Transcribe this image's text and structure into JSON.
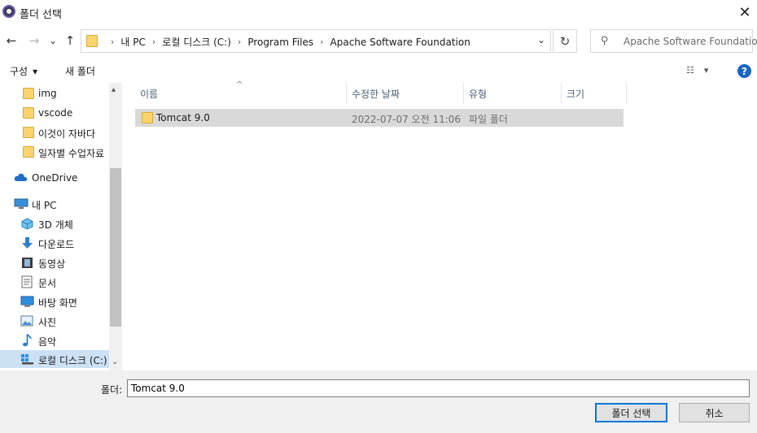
{
  "window": {
    "title": "폴더 선택",
    "close_glyph": "✕"
  },
  "nav": {
    "back_glyph": "←",
    "forward_glyph": "→",
    "recent_glyph": "⌄",
    "up_glyph": "↑",
    "breadcrumbs": [
      "내 PC",
      "로컬 디스크 (C:)",
      "Program Files",
      "Apache Software Foundation"
    ],
    "separator": "›",
    "dropdown_glyph": "⌄",
    "refresh_glyph": "↻",
    "search_placeholder": "Apache Software Foundatio..."
  },
  "toolbar": {
    "organize_label": "구성",
    "organize_arrow": "▾",
    "new_folder_label": "새 폴더",
    "view_glyph": "☷",
    "view_arrow": "▾",
    "help_glyph": "?"
  },
  "sidebar": {
    "items": [
      {
        "label": "img",
        "icon": "folder-icon",
        "selected": false
      },
      {
        "label": "vscode",
        "icon": "folder-icon",
        "selected": false
      },
      {
        "label": "이것이 자바다",
        "icon": "folder-icon",
        "selected": false
      },
      {
        "label": "일자별 수업자료",
        "icon": "folder-icon",
        "selected": false
      },
      {
        "label": "OneDrive",
        "icon": "cloud-icon",
        "selected": false
      },
      {
        "label": "내 PC",
        "icon": "computer-icon",
        "selected": false
      },
      {
        "label": "3D 개체",
        "icon": "cube-icon",
        "selected": false
      },
      {
        "label": "다운로드",
        "icon": "download-icon",
        "selected": false
      },
      {
        "label": "동영상",
        "icon": "video-icon",
        "selected": false
      },
      {
        "label": "문서",
        "icon": "document-icon",
        "selected": false
      },
      {
        "label": "바탕 화면",
        "icon": "desktop-icon",
        "selected": false
      },
      {
        "label": "사진",
        "icon": "picture-icon",
        "selected": false
      },
      {
        "label": "음악",
        "icon": "music-icon",
        "selected": false
      },
      {
        "label": "로컬 디스크 (C:)",
        "icon": "drive-icon",
        "selected": true
      }
    ],
    "scroll_up_glyph": "▴",
    "scroll_down_glyph": "⌄"
  },
  "filelist": {
    "columns": [
      "이름",
      "수정한 날짜",
      "유형",
      "크기"
    ],
    "sort_glyph": "^",
    "rows": [
      {
        "name": "Tomcat 9.0",
        "modified": "2022-07-07 오전 11:06",
        "type": "파일 폴더",
        "size": ""
      }
    ]
  },
  "footer": {
    "folder_label": "폴더:",
    "folder_value": "Tomcat 9.0",
    "select_button": "폴더 선택",
    "cancel_button": "취소"
  },
  "colors": {
    "accent": "#0078d7",
    "folder": "#f9d46e",
    "selection": "#cde1f5",
    "row_highlight": "#d9d9d9"
  }
}
